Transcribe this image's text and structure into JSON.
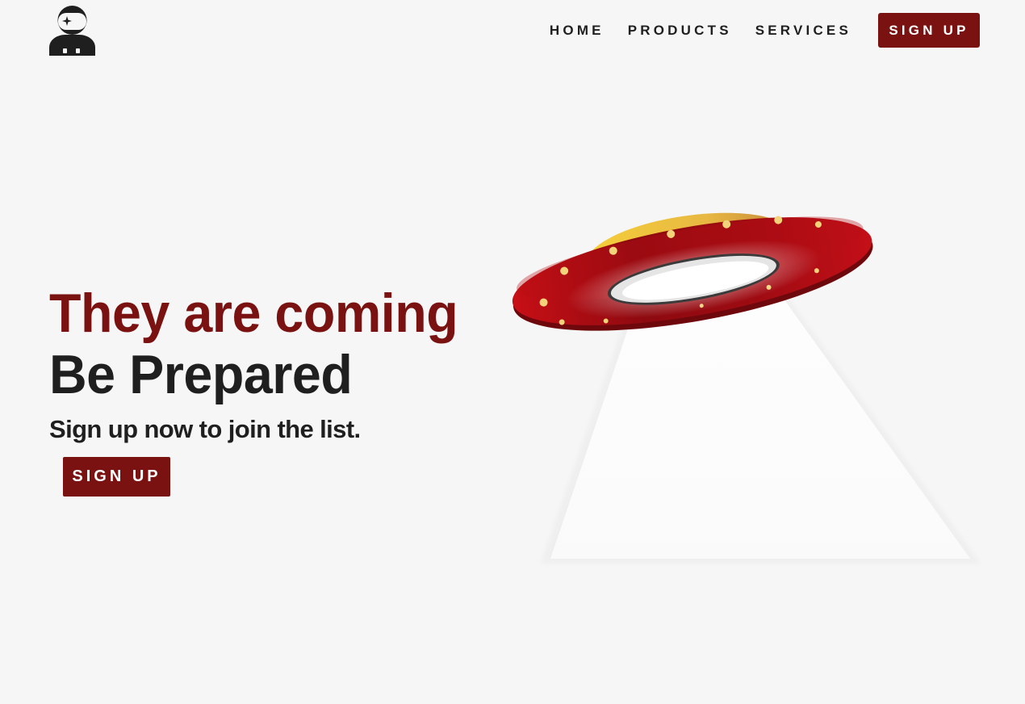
{
  "brand": {
    "logo_icon": "astronaut-icon"
  },
  "nav": {
    "links": [
      {
        "label": "HOME"
      },
      {
        "label": "PRODUCTS"
      },
      {
        "label": "SERVICES"
      }
    ],
    "cta_label": "SIGN UP"
  },
  "hero": {
    "headline_line1": "They are coming",
    "headline_line2": "Be Prepared",
    "subtitle": "Sign up now to join the list.",
    "cta_label": "SIGN UP",
    "illustration": "ufo-icon"
  },
  "colors": {
    "accent": "#7a1212",
    "text": "#1f1f1f",
    "background": "#f6f6f6"
  }
}
